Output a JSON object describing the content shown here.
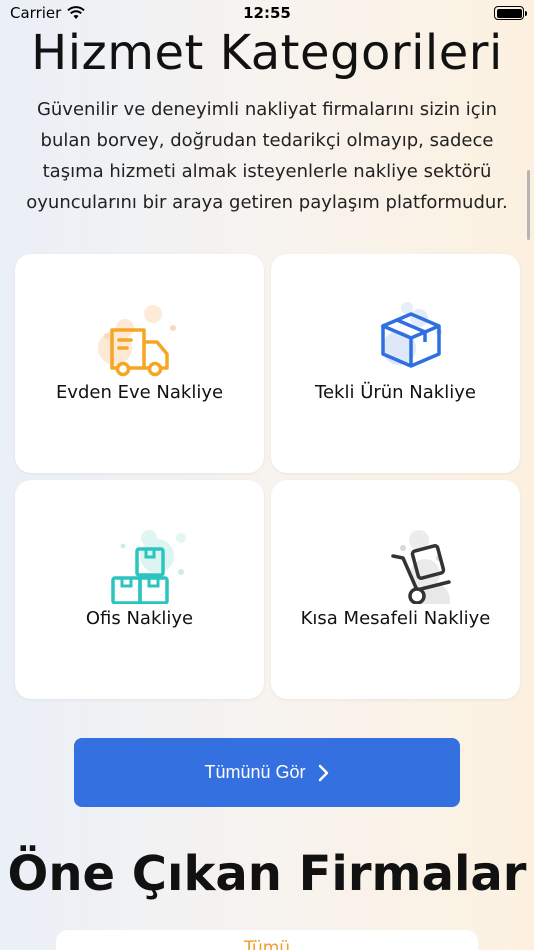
{
  "status": {
    "carrier": "Carrier",
    "time": "12:55"
  },
  "header": {
    "title": "Hizmet Kategorileri",
    "intro": "Güvenilir ve deneyimli nakliyat firmalarını sizin için bulan borvey, doğrudan tedarikçi olmayıp, sadece taşıma hizmeti almak isteyenlerle nakliye sektörü oyuncularını bir araya getiren paylaşım platformudur."
  },
  "categories": [
    {
      "label": "Evden Eve Nakliye",
      "icon": "truck-icon",
      "color": "#f5a623"
    },
    {
      "label": "Tekli Ürün Nakliye",
      "icon": "box-icon",
      "color": "#2f6fe0"
    },
    {
      "label": "Ofis Nakliye",
      "icon": "stacked-boxes-icon",
      "color": "#2cc4c0"
    },
    {
      "label": "Kısa Mesafeli Nakliye",
      "icon": "hand-truck-icon",
      "color": "#333333"
    }
  ],
  "cta": {
    "label": "Tümünü Gör",
    "color": "#3470df"
  },
  "featured": {
    "title": "Öne Çıkan Firmalar",
    "peek_text": "Tümü"
  }
}
